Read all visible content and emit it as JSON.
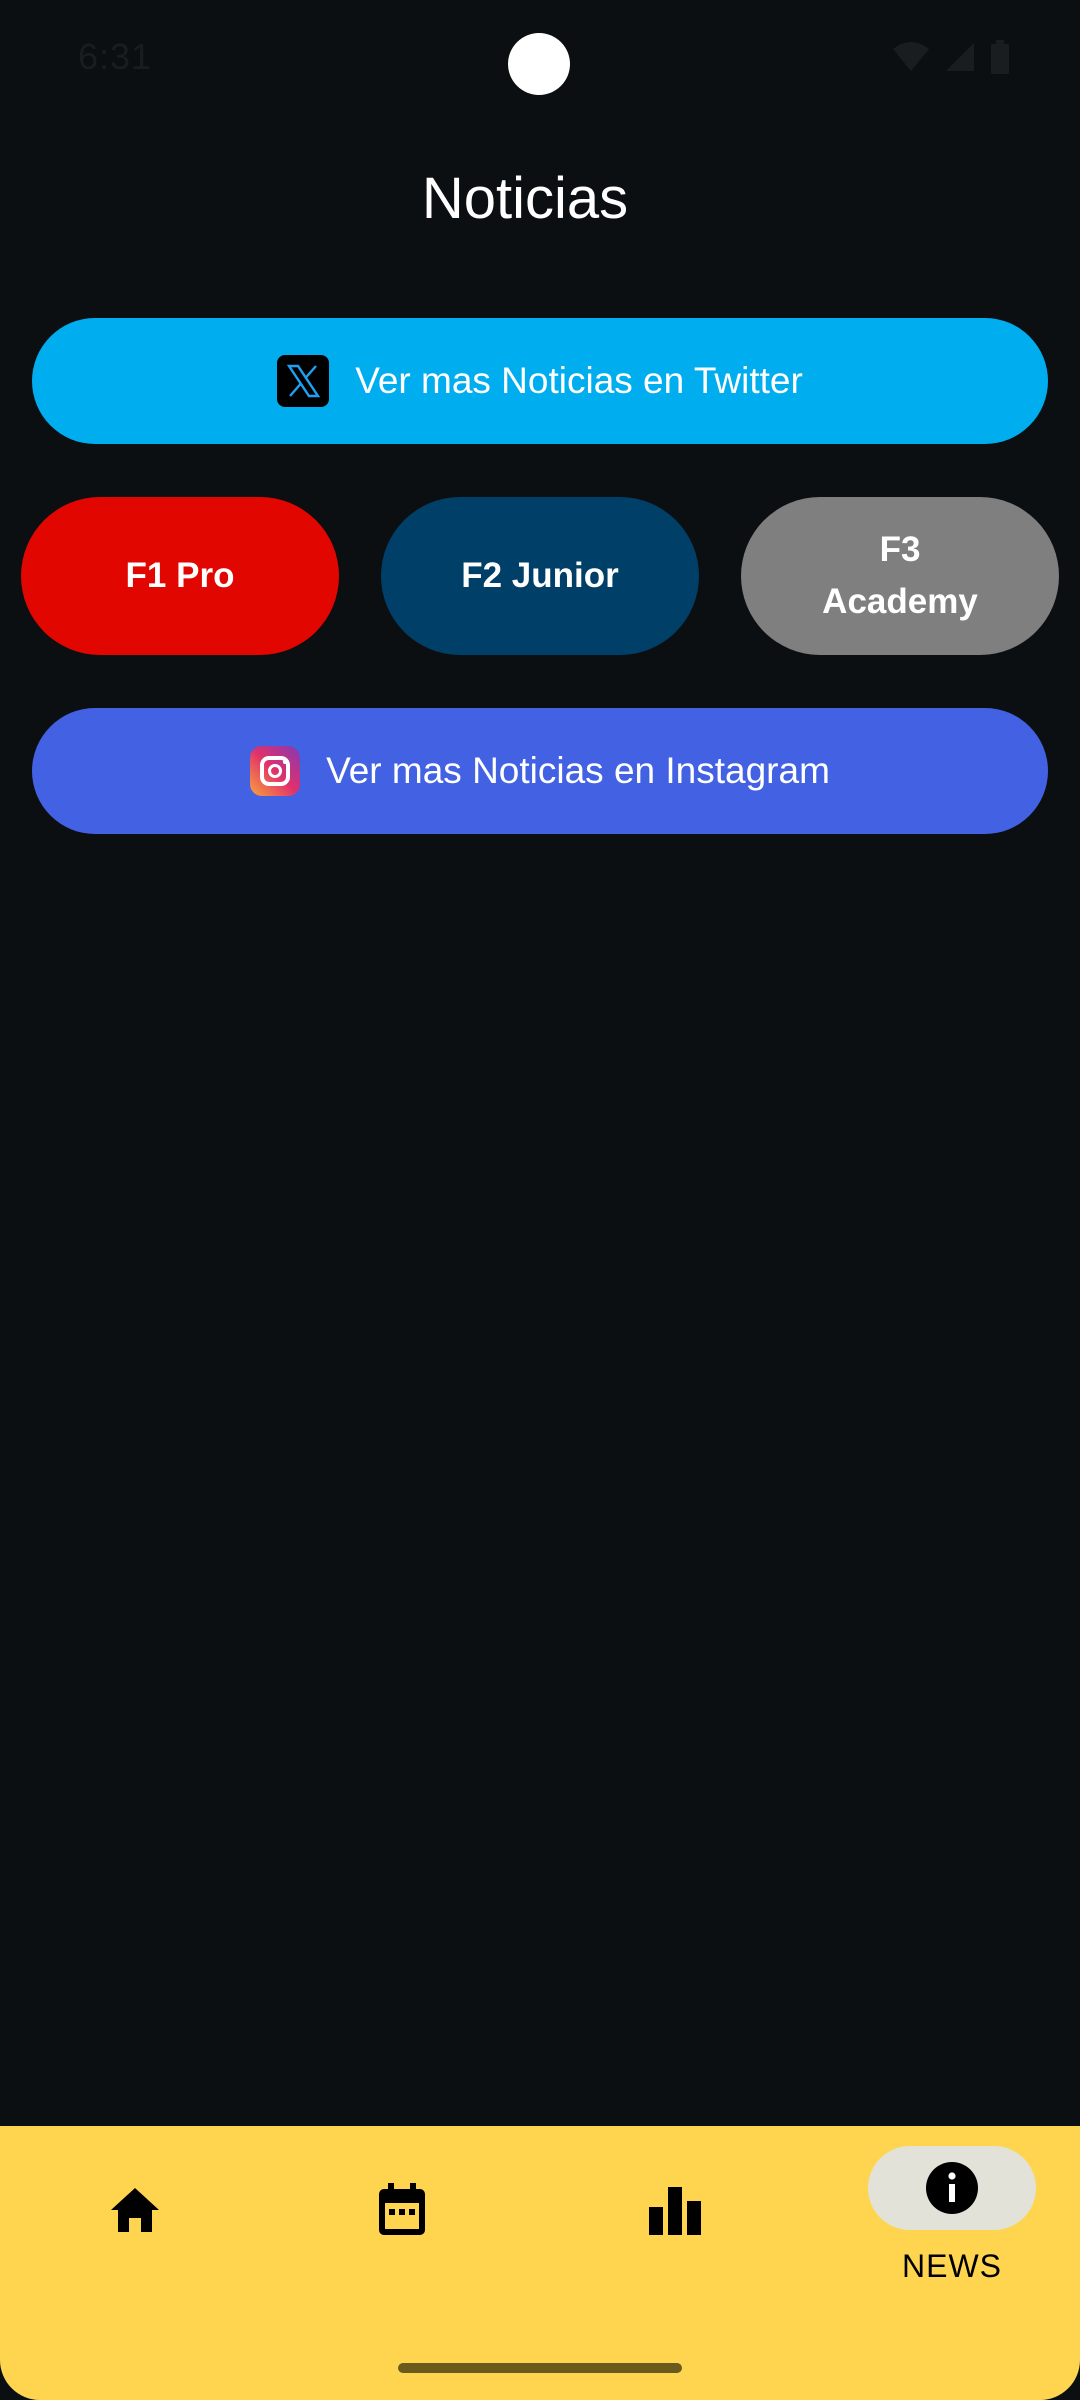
{
  "status_bar": {
    "time": "6:31",
    "icons": [
      "wifi-icon",
      "signal-icon",
      "battery-icon"
    ]
  },
  "page": {
    "title": "Noticias"
  },
  "twitter_button": {
    "label": "Ver mas Noticias en Twitter",
    "icon": "x-twitter-icon",
    "color": "#00adee"
  },
  "categories": [
    {
      "line1": "F1 Pro",
      "line2": "",
      "color": "#e10600"
    },
    {
      "line1": "F2 Junior",
      "line2": "",
      "color": "#003f68"
    },
    {
      "line1": "F3",
      "line2": "Academy",
      "color": "#7f7f7f"
    }
  ],
  "instagram_button": {
    "label": "Ver mas Noticias en Instagram",
    "icon": "instagram-icon",
    "color": "#4361e3"
  },
  "bottom_nav": {
    "background": "#ffd54f",
    "items": [
      {
        "icon": "home-icon",
        "label": "",
        "active": false
      },
      {
        "icon": "calendar-icon",
        "label": "",
        "active": false
      },
      {
        "icon": "bar-chart-icon",
        "label": "",
        "active": false
      },
      {
        "icon": "info-icon",
        "label": "NEWS",
        "active": true
      }
    ]
  }
}
